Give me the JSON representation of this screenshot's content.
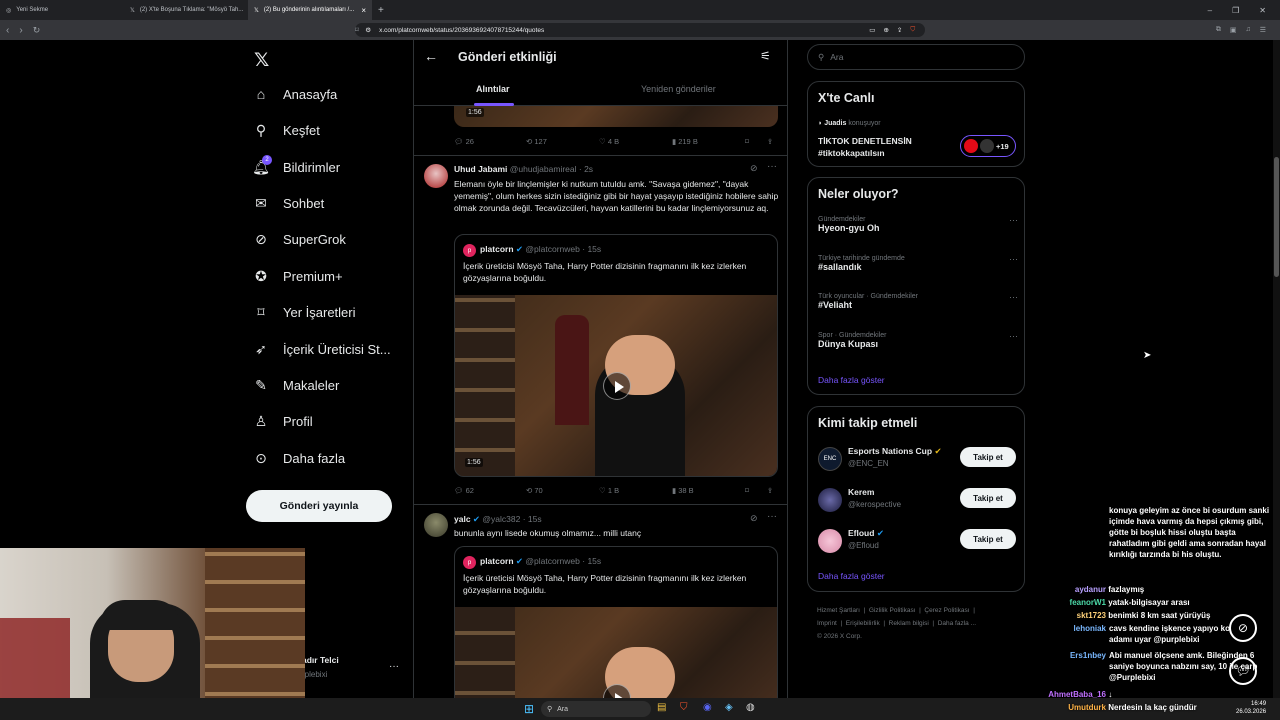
{
  "browser": {
    "tabs": [
      {
        "label": "Yeni Sekme"
      },
      {
        "label": "(2) X'te Boşuna Tıklama: \"Mösyö Tah..."
      },
      {
        "label": "(2) Bu gönderinin alıntılamaları /..."
      }
    ],
    "url": "x.com/platcornweb/status/2036936924078715244/quotes"
  },
  "nav": {
    "items": [
      {
        "label": "Anasayfa",
        "icon": "home-icon"
      },
      {
        "label": "Keşfet",
        "icon": "search-icon"
      },
      {
        "label": "Bildirimler",
        "icon": "bell-icon",
        "badge": "2"
      },
      {
        "label": "Sohbet",
        "icon": "mail-icon"
      },
      {
        "label": "SuperGrok",
        "icon": "grok-icon"
      },
      {
        "label": "Premium+",
        "icon": "verified-icon"
      },
      {
        "label": "Yer İşaretleri",
        "icon": "bookmark-icon"
      },
      {
        "label": "İçerik Üreticisi St...",
        "icon": "rocket-icon"
      },
      {
        "label": "Makaleler",
        "icon": "article-icon"
      },
      {
        "label": "Profil",
        "icon": "person-icon"
      },
      {
        "label": "Daha fazla",
        "icon": "more-circle-icon"
      }
    ],
    "post_button": "Gönderi yayınla",
    "account_name": "adır Telci",
    "account_handle": "rplebixi"
  },
  "header": {
    "title": "Gönderi etkinliği",
    "tabs": [
      "Alıntılar",
      "Yeniden gönderiler"
    ],
    "active_tab": "Alıntılar"
  },
  "top_partial": {
    "duration": "1:56",
    "actions": {
      "replies": "26",
      "reposts": "127",
      "likes": "4 B",
      "views": "219 B"
    }
  },
  "tweets": [
    {
      "name": "Uhud Jabami",
      "handle": "@uhudjabamireal",
      "time": "· 2s",
      "text": "Elemanı öyle bir linçlemişler ki nutkum tutuldu amk. \"Savaşa gidemez\", \"dayak yememiş\", olum herkes sizin istediğiniz gibi bir hayat yaşayıp istediğiniz hobilere sahip olmak zorunda değil. Tecavüzcüleri, hayvan katillerini bu kadar linçlemiyorsunuz aq.",
      "quote": {
        "name": "platcorn",
        "handle": "@platcornweb",
        "time": "· 15s",
        "text": "İçerik üreticisi Mösyö Taha, Harry Potter dizisinin fragmanını ilk kez izlerken gözyaşlarına boğuldu.",
        "duration": "1:56"
      },
      "actions": {
        "replies": "62",
        "reposts": "70",
        "likes": "1 B",
        "views": "38 B"
      }
    },
    {
      "name": "yalc",
      "handle": "@yalc382",
      "time": "· 15s",
      "text": "bununla aynı lisede okumuş olmamız... milli utanç",
      "quote": {
        "name": "platcorn",
        "handle": "@platcornweb",
        "time": "· 15s",
        "text": "İçerik üreticisi Mösyö Taha, Harry Potter dizisinin fragmanını ilk kez izlerken gözyaşlarına boğuldu."
      }
    }
  ],
  "sidebar": {
    "search_placeholder": "Ara",
    "live": {
      "title": "X'te Canlı",
      "host": "Juadis",
      "host_status": "konuşuyor",
      "topic_line1": "TİKTOK DENETLENSİN",
      "topic_line2": "#tiktokkapatılsın",
      "listeners": "+19"
    },
    "trends": {
      "title": "Neler oluyor?",
      "items": [
        {
          "context": "Gündemdekiler",
          "name": "Hyeon-gyu Oh"
        },
        {
          "context": "Türkiye tarihinde gündemde",
          "name": "#sallandık"
        },
        {
          "context": "Türk oyuncular · Gündemdekiler",
          "name": "#Veliaht"
        },
        {
          "context": "Spor · Gündemdekiler",
          "name": "Dünya Kupası"
        }
      ],
      "show_more": "Daha fazla göster"
    },
    "who_to_follow": {
      "title": "Kimi takip etmeli",
      "items": [
        {
          "name": "Esports Nations Cup",
          "handle": "@ENC_EN",
          "badge": "gold"
        },
        {
          "name": "Kerem",
          "handle": "@kerospective",
          "badge": ""
        },
        {
          "name": "Efloud",
          "handle": "@Efloud",
          "badge": "blue"
        }
      ],
      "follow_label": "Takip et",
      "show_more": "Daha fazla göster"
    },
    "footer": [
      "Hizmet Şartları",
      "Gizlilik Politikası",
      "Çerez Politikası",
      "Imprint",
      "Erişilebilirlik",
      "Reklam bilgisi",
      "Daha fazla ...",
      "© 2026 X Corp."
    ]
  },
  "chat": {
    "first_message": "konuya geleyim az önce bi osurdum sanki içimde hava varmış da hepsi çıkmış gibi, götte bi boşluk hissi oluştu başta rahatladım gibi geldi ama sonradan hayal kırıklığı tarzında bi his oluştu.",
    "messages": [
      {
        "user": "aydanur",
        "text": "fazlaymış"
      },
      {
        "user": "feanorW1",
        "text": "yatak-bilgisayar arası"
      },
      {
        "user": "skt1723",
        "text": "benimki 8 km saat yürüyüş"
      },
      {
        "user": "lehoniak",
        "text": "cavs kendine işkence yapıyo ko adamı uyar @purplebixi"
      },
      {
        "user": "Ers1nbey",
        "text": "Abi manuel ölçsene amk. Bileğinden 6 saniye boyunca nabzını say, 10 ile çarp @Purplebixi"
      },
      {
        "user": "AhmetBaba_16",
        "text": "↓"
      },
      {
        "user": "Umutdurk",
        "text": "Nerdesin la kaç gündür"
      }
    ]
  },
  "taskbar": {
    "search": "Ara",
    "time": "16:49",
    "date": "26.03.2026"
  }
}
